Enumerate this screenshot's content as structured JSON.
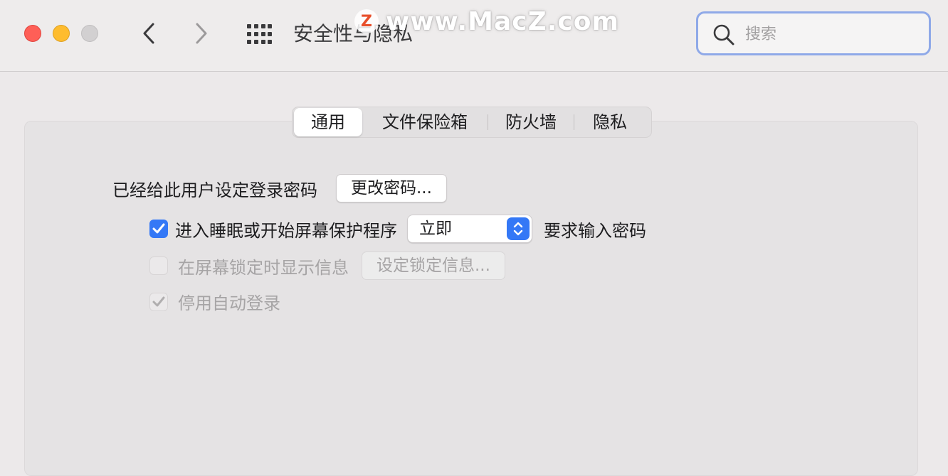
{
  "window": {
    "title": "安全性与隐私",
    "watermark_logo": "Z",
    "watermark_text": "www.MacZ.com"
  },
  "search": {
    "placeholder": "搜索",
    "value": ""
  },
  "tabs": [
    {
      "label": "通用",
      "active": true
    },
    {
      "label": "文件保险箱",
      "active": false
    },
    {
      "label": "防火墙",
      "active": false
    },
    {
      "label": "隐私",
      "active": false
    }
  ],
  "general": {
    "password_set_label": "已经给此用户设定登录密码",
    "change_password_button": "更改密码...",
    "require_password": {
      "checked": true,
      "label": "进入睡眠或开始屏幕保护程序",
      "delay_value": "立即",
      "suffix": "要求输入密码"
    },
    "lock_message": {
      "checked": false,
      "enabled": false,
      "label": "在屏幕锁定时显示信息",
      "button": "设定锁定信息..."
    },
    "disable_auto_login": {
      "checked": true,
      "enabled": false,
      "label": "停用自动登录"
    }
  },
  "colors": {
    "accent": "#3478f6",
    "search_focus_ring": "#8fa9e8"
  }
}
